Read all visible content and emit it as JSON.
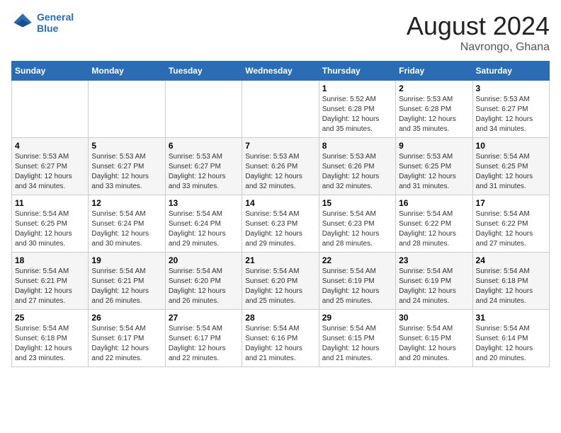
{
  "logo": {
    "line1": "General",
    "line2": "Blue"
  },
  "title": "August 2024",
  "location": "Navrongo, Ghana",
  "weekdays": [
    "Sunday",
    "Monday",
    "Tuesday",
    "Wednesday",
    "Thursday",
    "Friday",
    "Saturday"
  ],
  "weeks": [
    [
      {
        "day": "",
        "info": ""
      },
      {
        "day": "",
        "info": ""
      },
      {
        "day": "",
        "info": ""
      },
      {
        "day": "",
        "info": ""
      },
      {
        "day": "1",
        "info": "Sunrise: 5:52 AM\nSunset: 6:28 PM\nDaylight: 12 hours\nand 35 minutes."
      },
      {
        "day": "2",
        "info": "Sunrise: 5:53 AM\nSunset: 6:28 PM\nDaylight: 12 hours\nand 35 minutes."
      },
      {
        "day": "3",
        "info": "Sunrise: 5:53 AM\nSunset: 6:27 PM\nDaylight: 12 hours\nand 34 minutes."
      }
    ],
    [
      {
        "day": "4",
        "info": "Sunrise: 5:53 AM\nSunset: 6:27 PM\nDaylight: 12 hours\nand 34 minutes."
      },
      {
        "day": "5",
        "info": "Sunrise: 5:53 AM\nSunset: 6:27 PM\nDaylight: 12 hours\nand 33 minutes."
      },
      {
        "day": "6",
        "info": "Sunrise: 5:53 AM\nSunset: 6:27 PM\nDaylight: 12 hours\nand 33 minutes."
      },
      {
        "day": "7",
        "info": "Sunrise: 5:53 AM\nSunset: 6:26 PM\nDaylight: 12 hours\nand 32 minutes."
      },
      {
        "day": "8",
        "info": "Sunrise: 5:53 AM\nSunset: 6:26 PM\nDaylight: 12 hours\nand 32 minutes."
      },
      {
        "day": "9",
        "info": "Sunrise: 5:53 AM\nSunset: 6:25 PM\nDaylight: 12 hours\nand 31 minutes."
      },
      {
        "day": "10",
        "info": "Sunrise: 5:54 AM\nSunset: 6:25 PM\nDaylight: 12 hours\nand 31 minutes."
      }
    ],
    [
      {
        "day": "11",
        "info": "Sunrise: 5:54 AM\nSunset: 6:25 PM\nDaylight: 12 hours\nand 30 minutes."
      },
      {
        "day": "12",
        "info": "Sunrise: 5:54 AM\nSunset: 6:24 PM\nDaylight: 12 hours\nand 30 minutes."
      },
      {
        "day": "13",
        "info": "Sunrise: 5:54 AM\nSunset: 6:24 PM\nDaylight: 12 hours\nand 29 minutes."
      },
      {
        "day": "14",
        "info": "Sunrise: 5:54 AM\nSunset: 6:23 PM\nDaylight: 12 hours\nand 29 minutes."
      },
      {
        "day": "15",
        "info": "Sunrise: 5:54 AM\nSunset: 6:23 PM\nDaylight: 12 hours\nand 28 minutes."
      },
      {
        "day": "16",
        "info": "Sunrise: 5:54 AM\nSunset: 6:22 PM\nDaylight: 12 hours\nand 28 minutes."
      },
      {
        "day": "17",
        "info": "Sunrise: 5:54 AM\nSunset: 6:22 PM\nDaylight: 12 hours\nand 27 minutes."
      }
    ],
    [
      {
        "day": "18",
        "info": "Sunrise: 5:54 AM\nSunset: 6:21 PM\nDaylight: 12 hours\nand 27 minutes."
      },
      {
        "day": "19",
        "info": "Sunrise: 5:54 AM\nSunset: 6:21 PM\nDaylight: 12 hours\nand 26 minutes."
      },
      {
        "day": "20",
        "info": "Sunrise: 5:54 AM\nSunset: 6:20 PM\nDaylight: 12 hours\nand 26 minutes."
      },
      {
        "day": "21",
        "info": "Sunrise: 5:54 AM\nSunset: 6:20 PM\nDaylight: 12 hours\nand 25 minutes."
      },
      {
        "day": "22",
        "info": "Sunrise: 5:54 AM\nSunset: 6:19 PM\nDaylight: 12 hours\nand 25 minutes."
      },
      {
        "day": "23",
        "info": "Sunrise: 5:54 AM\nSunset: 6:19 PM\nDaylight: 12 hours\nand 24 minutes."
      },
      {
        "day": "24",
        "info": "Sunrise: 5:54 AM\nSunset: 6:18 PM\nDaylight: 12 hours\nand 24 minutes."
      }
    ],
    [
      {
        "day": "25",
        "info": "Sunrise: 5:54 AM\nSunset: 6:18 PM\nDaylight: 12 hours\nand 23 minutes."
      },
      {
        "day": "26",
        "info": "Sunrise: 5:54 AM\nSunset: 6:17 PM\nDaylight: 12 hours\nand 22 minutes."
      },
      {
        "day": "27",
        "info": "Sunrise: 5:54 AM\nSunset: 6:17 PM\nDaylight: 12 hours\nand 22 minutes."
      },
      {
        "day": "28",
        "info": "Sunrise: 5:54 AM\nSunset: 6:16 PM\nDaylight: 12 hours\nand 21 minutes."
      },
      {
        "day": "29",
        "info": "Sunrise: 5:54 AM\nSunset: 6:15 PM\nDaylight: 12 hours\nand 21 minutes."
      },
      {
        "day": "30",
        "info": "Sunrise: 5:54 AM\nSunset: 6:15 PM\nDaylight: 12 hours\nand 20 minutes."
      },
      {
        "day": "31",
        "info": "Sunrise: 5:54 AM\nSunset: 6:14 PM\nDaylight: 12 hours\nand 20 minutes."
      }
    ]
  ]
}
